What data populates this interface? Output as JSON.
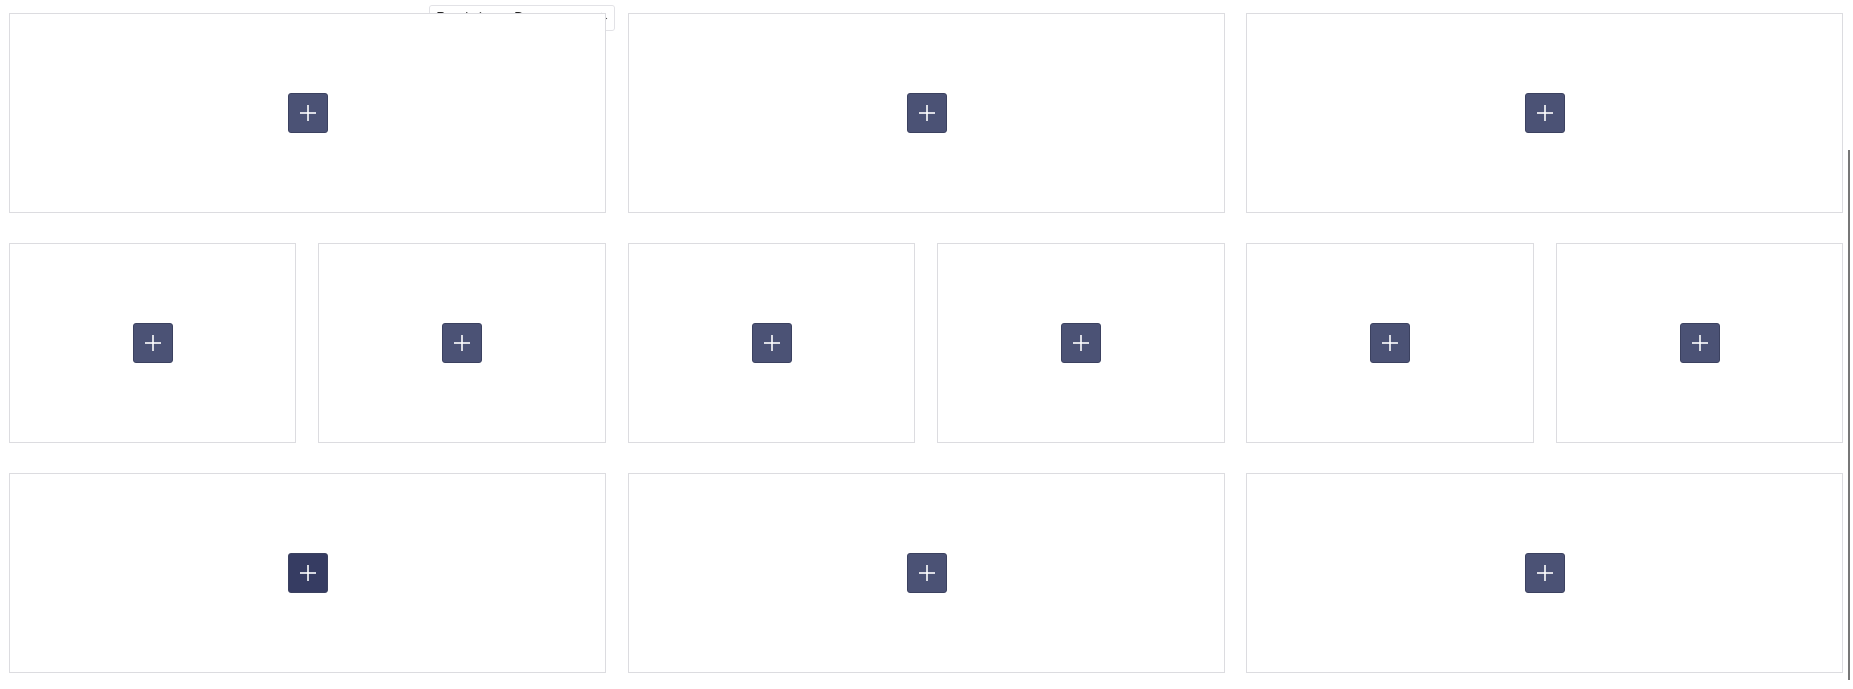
{
  "toolbar": {
    "label": "Bootstrap Row",
    "icons": [
      "delete-icon",
      "settings-icon",
      "move-icon"
    ]
  },
  "add_button_symbol": "+",
  "rows": [
    {
      "name": "row-1",
      "columns": 3
    },
    {
      "name": "row-2",
      "columns": 6
    },
    {
      "name": "row-3",
      "columns": 3
    }
  ],
  "colors": {
    "button": "#4b5275",
    "button_active": "#363c62",
    "border": "#dcdce0"
  }
}
